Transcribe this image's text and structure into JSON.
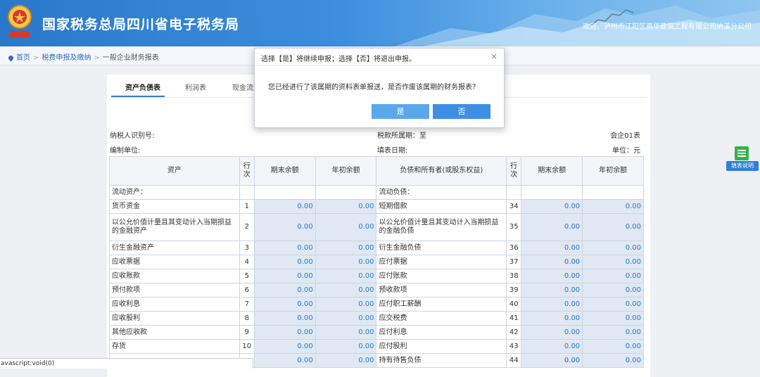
{
  "header": {
    "site_title": "国家税务总局四川省电子税务局",
    "welcome": "欢迎，泸州市江阳区南华建筑工程有限公司纳溪分公司"
  },
  "breadcrumb": {
    "home": "首页",
    "level1": "税费申报及缴纳",
    "level2": "一般企业财务报表"
  },
  "tabs": [
    "资产负债表",
    "利润表",
    "现金流量"
  ],
  "meta": {
    "taxpayer_id_label": "纳税人识别号:",
    "company_label": "编制单位:",
    "period_label": "税款所属期：至",
    "fill_date_label": "填表日期:",
    "form_code": "会企01表",
    "unit": "单位：元"
  },
  "table": {
    "headers": [
      "资产",
      "行次",
      "期末余额",
      "年初余额",
      "负债和所有者(或股东权益)",
      "行次",
      "期末余额",
      "年初余额"
    ],
    "section_left": "流动资产：",
    "section_right": "流动负债：",
    "rows": [
      {
        "l_name": "货币资金",
        "l_no": "1",
        "l_end": "0.00",
        "l_begin": "0.00",
        "r_name": "短期借款",
        "r_no": "34",
        "r_end": "0.00",
        "r_begin": "0.00"
      },
      {
        "l_name": "以公允价值计量且其变动计入当期损益的金融资产",
        "l_no": "2",
        "l_end": "0.00",
        "l_begin": "0.00",
        "r_name": "以公允价值计量且其变动计入当期损益的金融负债",
        "r_no": "35",
        "r_end": "0.00",
        "r_begin": "0.00"
      },
      {
        "l_name": "衍生金融资产",
        "l_no": "3",
        "l_end": "0.00",
        "l_begin": "0.00",
        "r_name": "衍生金融负债",
        "r_no": "36",
        "r_end": "0.00",
        "r_begin": "0.00"
      },
      {
        "l_name": "应收票据",
        "l_no": "4",
        "l_end": "0.00",
        "l_begin": "0.00",
        "r_name": "应付票据",
        "r_no": "37",
        "r_end": "0.00",
        "r_begin": "0.00"
      },
      {
        "l_name": "应收账款",
        "l_no": "5",
        "l_end": "0.00",
        "l_begin": "0.00",
        "r_name": "应付账款",
        "r_no": "38",
        "r_end": "0.00",
        "r_begin": "0.00"
      },
      {
        "l_name": "预付款项",
        "l_no": "6",
        "l_end": "0.00",
        "l_begin": "0.00",
        "r_name": "预收款项",
        "r_no": "39",
        "r_end": "0.00",
        "r_begin": "0.00"
      },
      {
        "l_name": "应收利息",
        "l_no": "7",
        "l_end": "0.00",
        "l_begin": "0.00",
        "r_name": "应付职工薪酬",
        "r_no": "40",
        "r_end": "0.00",
        "r_begin": "0.00"
      },
      {
        "l_name": "应收股利",
        "l_no": "8",
        "l_end": "0.00",
        "l_begin": "0.00",
        "r_name": "应交税费",
        "r_no": "41",
        "r_end": "0.00",
        "r_begin": "0.00"
      },
      {
        "l_name": "其他应收款",
        "l_no": "9",
        "l_end": "0.00",
        "l_begin": "0.00",
        "r_name": "应付利息",
        "r_no": "42",
        "r_end": "0.00",
        "r_begin": "0.00"
      },
      {
        "l_name": "存货",
        "l_no": "10",
        "l_end": "0.00",
        "l_begin": "0.00",
        "r_name": "应付股利",
        "r_no": "43",
        "r_end": "0.00",
        "r_begin": "0.00"
      },
      {
        "l_name": "",
        "l_no": "",
        "l_end": "0.00",
        "l_begin": "0.00",
        "r_name": "持有待售负债",
        "r_no": "44",
        "r_end": "0.00",
        "r_begin": "0.00"
      }
    ]
  },
  "help": {
    "label": "填表说明"
  },
  "modal": {
    "title": "选择【是】将继续申报；选择【否】将退出申报。",
    "close": "×",
    "message": "您已经进行了该属期的资料表单报送，是否作废该属期的财务报表？",
    "yes": "是",
    "no": "否"
  },
  "status_bar": "avascript:void(0)",
  "colors": {
    "header_blue": "#2a78c9",
    "value_blue": "#2a79d0",
    "button_blue": "#3d8fe3",
    "help_green": "#33b34a"
  }
}
